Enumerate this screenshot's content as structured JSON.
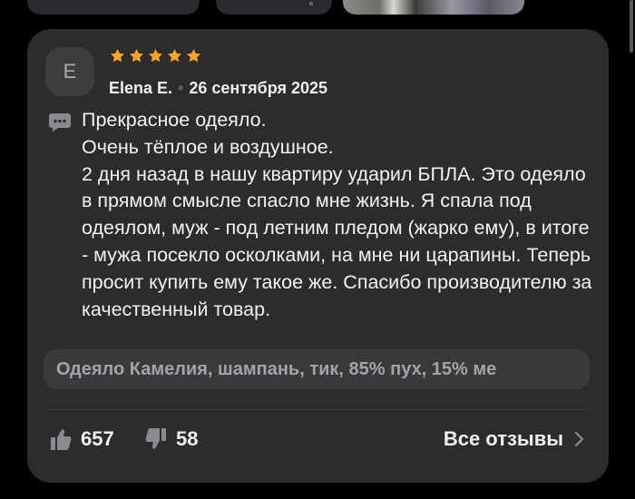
{
  "review": {
    "avatar_initial": "E",
    "rating": 5,
    "author": "Elena E.",
    "date": "26 сентября 2025",
    "text": "Прекрасное одеяло.\nОчень тёплое и воздушное.\n2 дня назад в нашу квартиру ударил БПЛА. Это одеяло в прямом смысле спасло мне жизнь. Я спала под одеялом, муж - под летним пледом (жарко ему), в итоге - мужа посекло осколками, на мне ни царапины. Теперь просит купить ему такое же. Спасибо производителю за качественный товар.",
    "variant": "Одеяло Камелия, шампань, тик, 85% пух, 15% ме"
  },
  "footer": {
    "likes": "657",
    "dislikes": "58",
    "all_reviews_label": "Все отзывы"
  },
  "colors": {
    "card_bg": "#2c2c2e",
    "star": "#f5a623",
    "variant_bg": "#3a3a3d",
    "icon_gray": "#8a8a8f"
  },
  "icons": {
    "rating": "star-icon",
    "comment": "chat-bubble-icon",
    "like": "thumbs-up-icon",
    "dislike": "thumbs-down-icon",
    "chevron": "chevron-right-icon"
  }
}
